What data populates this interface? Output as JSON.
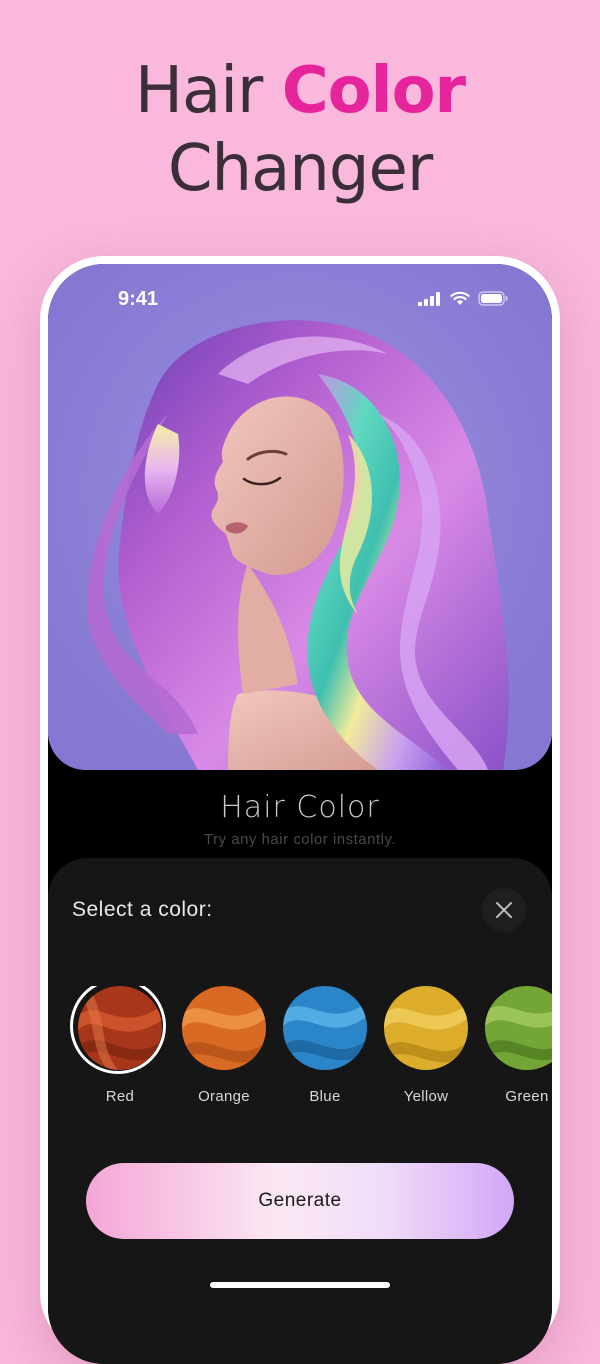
{
  "headline": {
    "part1": "Hair ",
    "accent": "Color",
    "line2": "Changer"
  },
  "status_bar": {
    "time": "9:41"
  },
  "feature": {
    "title": "Hair Color",
    "subtitle": "Try any hair color instantly."
  },
  "sheet": {
    "title": "Select a color:",
    "swatches": [
      {
        "label": "Red",
        "color": "#b8401f",
        "selected": true
      },
      {
        "label": "Orange",
        "color": "#e0762e",
        "selected": false
      },
      {
        "label": "Blue",
        "color": "#2f8fd0",
        "selected": false
      },
      {
        "label": "Yellow",
        "color": "#e3b430",
        "selected": false
      },
      {
        "label": "Green",
        "color": "#7fae3a",
        "selected": false
      }
    ],
    "generate_label": "Generate"
  },
  "colors": {
    "background": "#f9b8dc",
    "accent": "#e6259d",
    "hero_bg": "#8d80d6"
  }
}
